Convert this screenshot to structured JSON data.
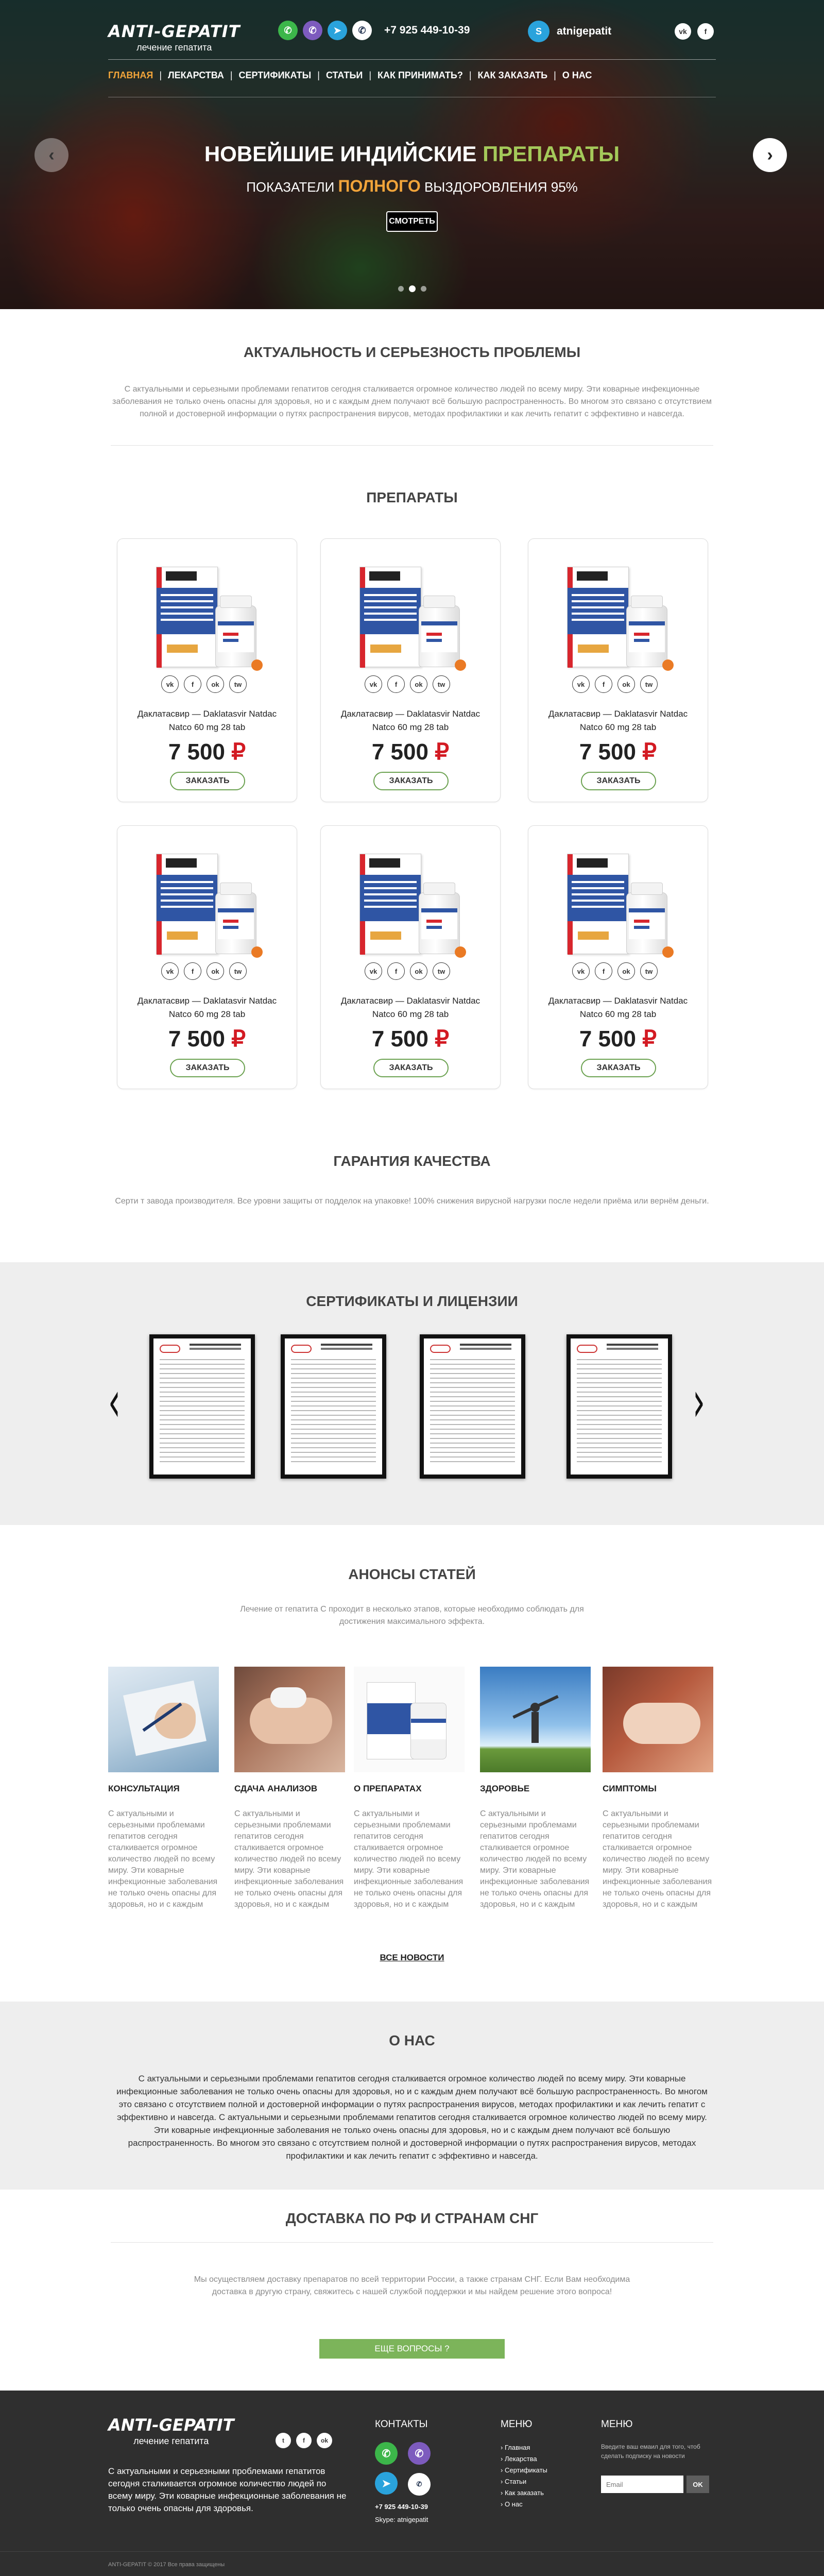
{
  "brand": {
    "name": "ANTI-GEPATIT",
    "tagline": "лечение гепатита"
  },
  "header": {
    "phone": "+7 925 449-10-39",
    "skype": "atnigepatit",
    "contact_icons": [
      "whatsapp-icon",
      "viber-icon",
      "telegram-icon",
      "phone-icon"
    ],
    "social": [
      "vk-icon",
      "facebook-icon"
    ]
  },
  "nav": [
    {
      "label": "Главная",
      "active": true
    },
    {
      "label": "Лекарства"
    },
    {
      "label": "Сертификаты"
    },
    {
      "label": "Статьи"
    },
    {
      "label": "Как принимать?"
    },
    {
      "label": "Как заказать"
    },
    {
      "label": "О нас"
    }
  ],
  "hero": {
    "title_pre": "Новейшие индийские",
    "title_hl": "препараты",
    "sub_pre": "Показатели",
    "sub_hl": "полного",
    "sub_post": "выздоровления 95%",
    "button": "Смотреть",
    "prev": "‹",
    "next": "›"
  },
  "problem": {
    "title": "Актуальность и серьезность проблемы",
    "text": "С актуальными и серьезными проблемами гепатитов сегодня сталкивается огромное количество людей по всему миру. Эти коварные инфекционные заболевания не только очень опасны для здоровья, но и с каждым днем получают всё большую распространенность. Во многом это связано с отсутствием полной и достоверной информации о путях распространения вирусов, методах профилактики и как лечить гепатит с эффективно и навсегда."
  },
  "products": {
    "title": "Препараты",
    "items": [
      {
        "name": "Даклатасвир — Daklatasvir Natdac Natco 60 mg 28 tab",
        "price": "7 500",
        "currency": "₽",
        "button": "Заказать"
      },
      {
        "name": "Даклатасвир — Daklatasvir Natdac Natco 60 mg 28 tab",
        "price": "7 500",
        "currency": "₽",
        "button": "Заказать"
      },
      {
        "name": "Даклатасвир — Daklatasvir Natdac Natco 60 mg 28 tab",
        "price": "7 500",
        "currency": "₽",
        "button": "Заказать"
      },
      {
        "name": "Даклатасвир — Daklatasvir Natdac Natco 60 mg 28 tab",
        "price": "7 500",
        "currency": "₽",
        "button": "Заказать"
      },
      {
        "name": "Даклатасвир — Daklatasvir Natdac Natco 60 mg 28 tab",
        "price": "7 500",
        "currency": "₽",
        "button": "Заказать"
      },
      {
        "name": "Даклатасвир — Daklatasvir Natdac Natco 60 mg 28 tab",
        "price": "7 500",
        "currency": "₽",
        "button": "Заказать"
      }
    ],
    "share_icons": [
      "vk",
      "f",
      "ok",
      "tw"
    ]
  },
  "guarantee": {
    "title": "Гарантия качества",
    "text": "Серти  т завода производителя. Все уровни защиты от подделок на упаковке! 100% снижения вирусной нагрузки после недели приёма или вернём деньги."
  },
  "certificates": {
    "title": "Сертификаты и лицензии",
    "prev": "‹",
    "next": "›"
  },
  "articles": {
    "title": "Анонсы статей",
    "intro": "Лечение от гепатита С проходит в несколько этапов, которые необходимо соблюдать для достижения максимального эффекта.",
    "items": [
      {
        "title": "Консультация",
        "text": "С актуальными и серьезными проблемами гепатитов сегодня сталкивается огромное количество людей по всему миру. Эти коварные инфекционные заболевания не только очень опасны для здоровья, но и с каждым"
      },
      {
        "title": "Сдача анализов",
        "text": "С актуальными и серьезными проблемами гепатитов сегодня сталкивается огромное количество людей по всему миру. Эти коварные инфекционные заболевания не только очень опасны для здоровья, но и с каждым"
      },
      {
        "title": "О препаратах",
        "text": "С актуальными и серьезными проблемами гепатитов сегодня сталкивается огромное количество людей по всему миру. Эти коварные инфекционные заболевания не только очень опасны для здоровья, но и с каждым"
      },
      {
        "title": "Здоровье",
        "text": "С актуальными и серьезными проблемами гепатитов сегодня сталкивается огромное количество людей по всему миру. Эти коварные инфекционные заболевания не только очень опасны для здоровья, но и с каждым"
      },
      {
        "title": "Симптомы",
        "text": "С актуальными и серьезными проблемами гепатитов сегодня сталкивается огромное количество людей по всему миру. Эти коварные инфекционные заболевания не только очень опасны для здоровья, но и с каждым"
      }
    ],
    "all_news": "Все новости"
  },
  "about": {
    "title": "О нас",
    "text": "С актуальными и серьезными проблемами гепатитов сегодня сталкивается огромное количество людей по всему миру. Эти коварные инфекционные заболевания не только очень опасны для здоровья, но и с каждым днем получают всё большую распространенность. Во многом это связано с отсутствием полной и достоверной информации о путях распространения вирусов, методах профилактики и как лечить гепатит с эффективно и навсегда. С актуальными и серьезными проблемами гепатитов сегодня сталкивается огромное количество людей по всему миру. Эти коварные инфекционные заболевания не только очень опасны для здоровья, но и с каждым днем получают всё большую распространенность. Во многом это связано с отсутствием полной и достоверной информации о путях распространения вирусов, методах профилактики и как лечить гепатит с эффективно и навсегда."
  },
  "delivery": {
    "title": "Доставка по РФ и странам СНГ",
    "text": "Мы осуществляем доставку препаратов по всей территории России, а также странам СНГ. Если Вам необходима доставка в другую страну, свяжитесь с нашей службой поддержки и мы найдем решение этого вопроса!",
    "button": "Еще вопросы ?"
  },
  "footer": {
    "text": "С актуальными и серьезными проблемами гепатитов сегодня сталкивается огромное количество людей по всему миру. Эти коварные инфекционные заболевания не только очень опасны для здоровья.",
    "contacts_title": "Контакты",
    "phone": "+7 925 449-10-39",
    "skype": "Skype: atnigepatit",
    "menu_title": "Меню",
    "menu": [
      "Главная",
      "Лекарства",
      "Сертификаты",
      "Статьи",
      "Как заказать",
      "О нас"
    ],
    "news_title": "Меню",
    "news_text": "Введите ваш емаил для того, чтоб сделать подписку на новости",
    "email_placeholder": "Email",
    "ok": "OK",
    "copyright": "ANTI-GEPATIT © 2017 Все права защищены"
  }
}
